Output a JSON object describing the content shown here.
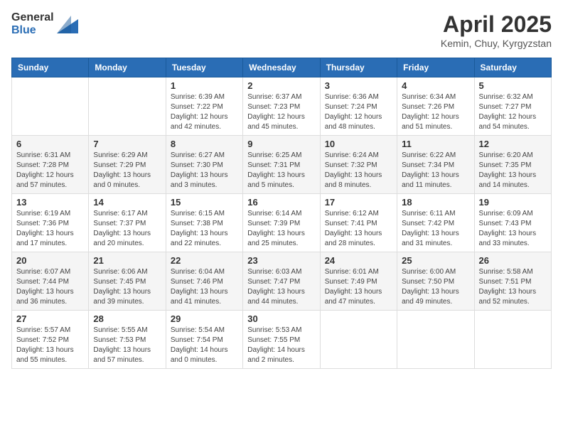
{
  "header": {
    "logo_general": "General",
    "logo_blue": "Blue",
    "month_title": "April 2025",
    "location": "Kemin, Chuy, Kyrgyzstan"
  },
  "weekdays": [
    "Sunday",
    "Monday",
    "Tuesday",
    "Wednesday",
    "Thursday",
    "Friday",
    "Saturday"
  ],
  "weeks": [
    [
      {
        "day": "",
        "info": ""
      },
      {
        "day": "",
        "info": ""
      },
      {
        "day": "1",
        "info": "Sunrise: 6:39 AM\nSunset: 7:22 PM\nDaylight: 12 hours\nand 42 minutes."
      },
      {
        "day": "2",
        "info": "Sunrise: 6:37 AM\nSunset: 7:23 PM\nDaylight: 12 hours\nand 45 minutes."
      },
      {
        "day": "3",
        "info": "Sunrise: 6:36 AM\nSunset: 7:24 PM\nDaylight: 12 hours\nand 48 minutes."
      },
      {
        "day": "4",
        "info": "Sunrise: 6:34 AM\nSunset: 7:26 PM\nDaylight: 12 hours\nand 51 minutes."
      },
      {
        "day": "5",
        "info": "Sunrise: 6:32 AM\nSunset: 7:27 PM\nDaylight: 12 hours\nand 54 minutes."
      }
    ],
    [
      {
        "day": "6",
        "info": "Sunrise: 6:31 AM\nSunset: 7:28 PM\nDaylight: 12 hours\nand 57 minutes."
      },
      {
        "day": "7",
        "info": "Sunrise: 6:29 AM\nSunset: 7:29 PM\nDaylight: 13 hours\nand 0 minutes."
      },
      {
        "day": "8",
        "info": "Sunrise: 6:27 AM\nSunset: 7:30 PM\nDaylight: 13 hours\nand 3 minutes."
      },
      {
        "day": "9",
        "info": "Sunrise: 6:25 AM\nSunset: 7:31 PM\nDaylight: 13 hours\nand 5 minutes."
      },
      {
        "day": "10",
        "info": "Sunrise: 6:24 AM\nSunset: 7:32 PM\nDaylight: 13 hours\nand 8 minutes."
      },
      {
        "day": "11",
        "info": "Sunrise: 6:22 AM\nSunset: 7:34 PM\nDaylight: 13 hours\nand 11 minutes."
      },
      {
        "day": "12",
        "info": "Sunrise: 6:20 AM\nSunset: 7:35 PM\nDaylight: 13 hours\nand 14 minutes."
      }
    ],
    [
      {
        "day": "13",
        "info": "Sunrise: 6:19 AM\nSunset: 7:36 PM\nDaylight: 13 hours\nand 17 minutes."
      },
      {
        "day": "14",
        "info": "Sunrise: 6:17 AM\nSunset: 7:37 PM\nDaylight: 13 hours\nand 20 minutes."
      },
      {
        "day": "15",
        "info": "Sunrise: 6:15 AM\nSunset: 7:38 PM\nDaylight: 13 hours\nand 22 minutes."
      },
      {
        "day": "16",
        "info": "Sunrise: 6:14 AM\nSunset: 7:39 PM\nDaylight: 13 hours\nand 25 minutes."
      },
      {
        "day": "17",
        "info": "Sunrise: 6:12 AM\nSunset: 7:41 PM\nDaylight: 13 hours\nand 28 minutes."
      },
      {
        "day": "18",
        "info": "Sunrise: 6:11 AM\nSunset: 7:42 PM\nDaylight: 13 hours\nand 31 minutes."
      },
      {
        "day": "19",
        "info": "Sunrise: 6:09 AM\nSunset: 7:43 PM\nDaylight: 13 hours\nand 33 minutes."
      }
    ],
    [
      {
        "day": "20",
        "info": "Sunrise: 6:07 AM\nSunset: 7:44 PM\nDaylight: 13 hours\nand 36 minutes."
      },
      {
        "day": "21",
        "info": "Sunrise: 6:06 AM\nSunset: 7:45 PM\nDaylight: 13 hours\nand 39 minutes."
      },
      {
        "day": "22",
        "info": "Sunrise: 6:04 AM\nSunset: 7:46 PM\nDaylight: 13 hours\nand 41 minutes."
      },
      {
        "day": "23",
        "info": "Sunrise: 6:03 AM\nSunset: 7:47 PM\nDaylight: 13 hours\nand 44 minutes."
      },
      {
        "day": "24",
        "info": "Sunrise: 6:01 AM\nSunset: 7:49 PM\nDaylight: 13 hours\nand 47 minutes."
      },
      {
        "day": "25",
        "info": "Sunrise: 6:00 AM\nSunset: 7:50 PM\nDaylight: 13 hours\nand 49 minutes."
      },
      {
        "day": "26",
        "info": "Sunrise: 5:58 AM\nSunset: 7:51 PM\nDaylight: 13 hours\nand 52 minutes."
      }
    ],
    [
      {
        "day": "27",
        "info": "Sunrise: 5:57 AM\nSunset: 7:52 PM\nDaylight: 13 hours\nand 55 minutes."
      },
      {
        "day": "28",
        "info": "Sunrise: 5:55 AM\nSunset: 7:53 PM\nDaylight: 13 hours\nand 57 minutes."
      },
      {
        "day": "29",
        "info": "Sunrise: 5:54 AM\nSunset: 7:54 PM\nDaylight: 14 hours\nand 0 minutes."
      },
      {
        "day": "30",
        "info": "Sunrise: 5:53 AM\nSunset: 7:55 PM\nDaylight: 14 hours\nand 2 minutes."
      },
      {
        "day": "",
        "info": ""
      },
      {
        "day": "",
        "info": ""
      },
      {
        "day": "",
        "info": ""
      }
    ]
  ]
}
